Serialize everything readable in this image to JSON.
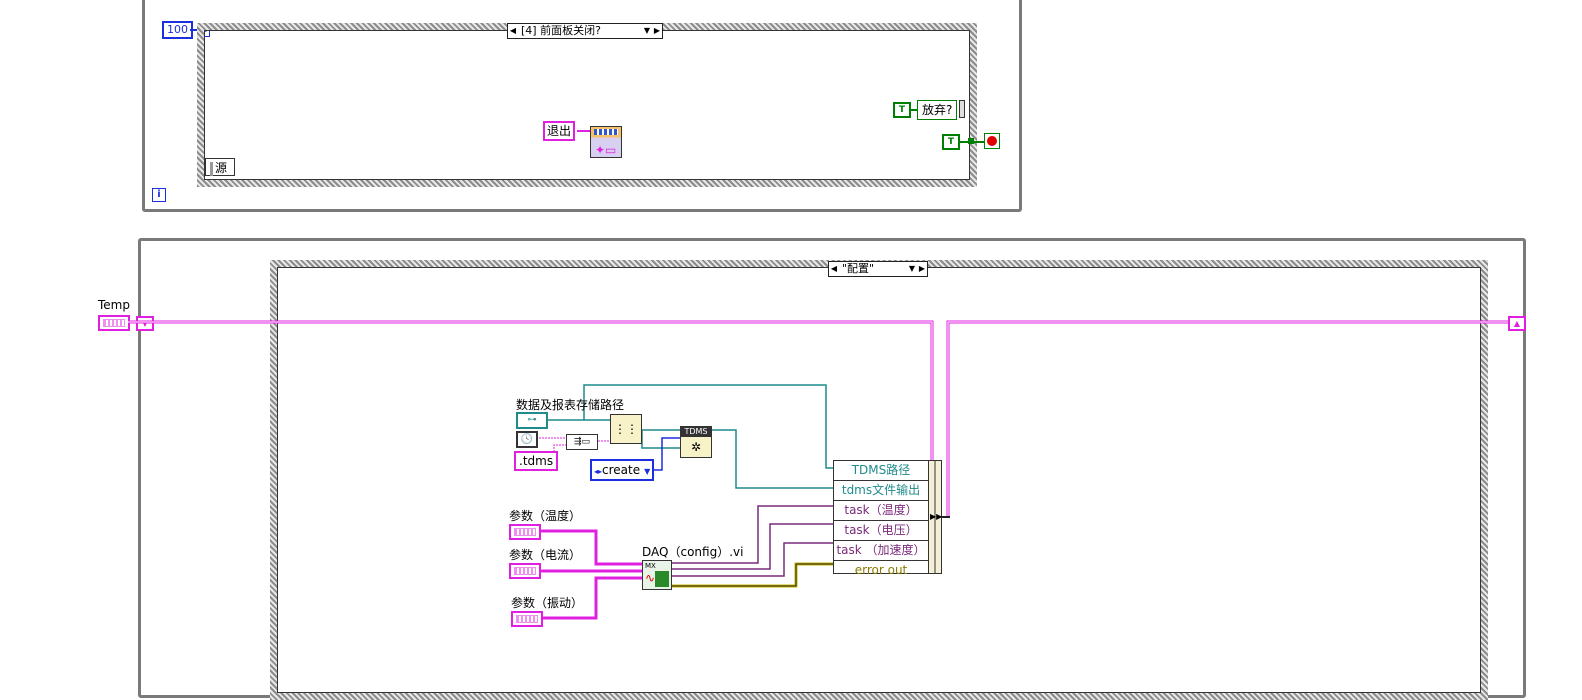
{
  "top_loop": {
    "wait_ms": "100",
    "iteration_label": "i",
    "case": {
      "selector_label": "[4] 前面板关闭?",
      "source_label": "源",
      "exit_string": "退出",
      "discard_label": "放弃?",
      "bool_const": "T"
    }
  },
  "bottom_loop": {
    "temp_label": "Temp",
    "case": {
      "selector_label": "\"配置\"",
      "path_label": "数据及报表存储路径",
      "ext_string": ".tdms",
      "create_enum": "create",
      "tdms_icon": "TDMS",
      "param_temp": "参数（温度）",
      "param_current": "参数（电流）",
      "param_vibration": "参数（振动）",
      "daq_label": "DAQ（config）.vi",
      "bundle_rows": [
        "TDMS路径",
        "tdms文件输出",
        "task（温度）",
        "task（电压）",
        "task （加速度）",
        "error out"
      ]
    }
  },
  "colors": {
    "cluster_wire": "#e020e0",
    "path_wire": "#1f8b8b",
    "numeric_blue": "#1b2ee0",
    "boolean_green": "#008000",
    "error_wire": "#c8b400"
  }
}
